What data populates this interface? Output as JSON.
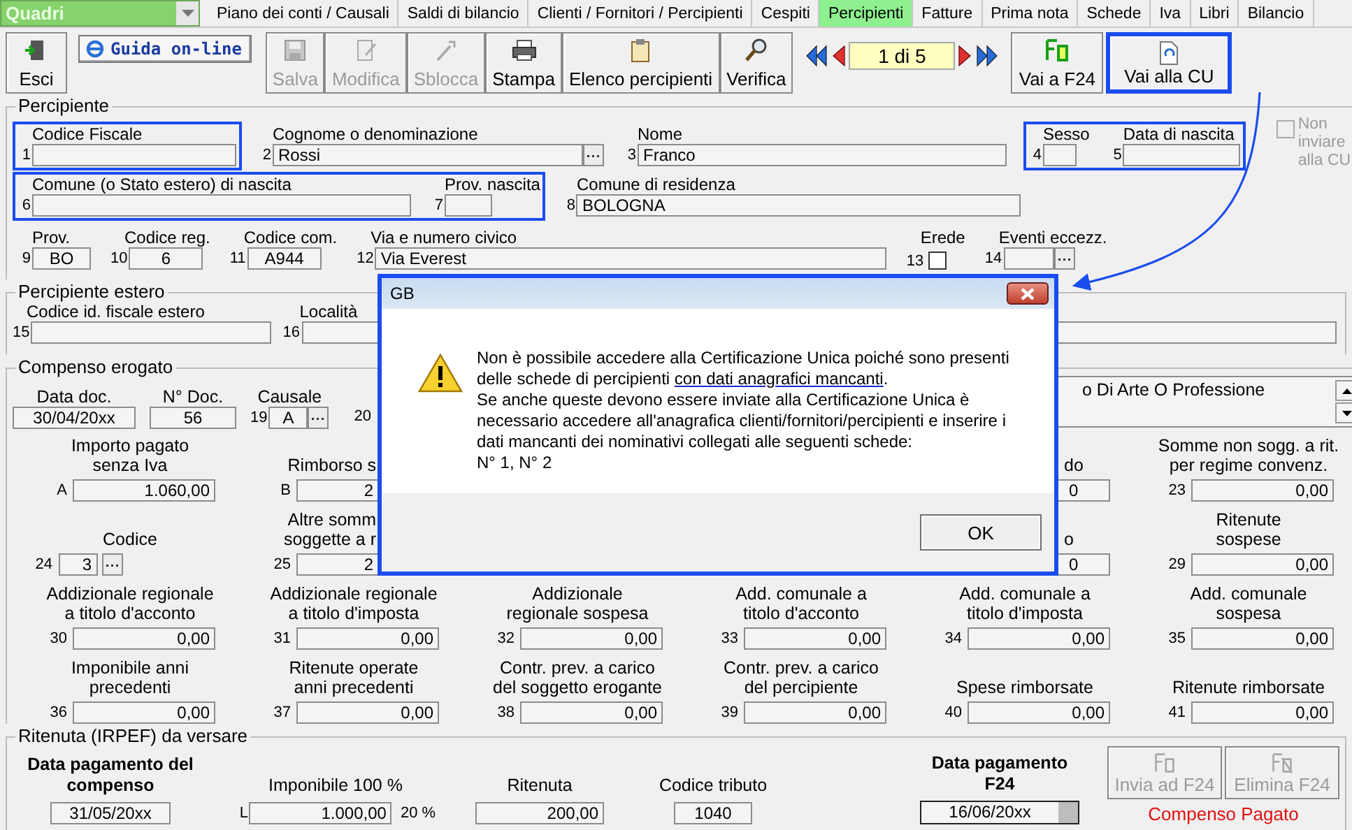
{
  "top_bar": {
    "selector": {
      "value": "Quadri"
    },
    "tabs": [
      {
        "label": "Piano dei conti / Causali",
        "selected": false
      },
      {
        "label": "Saldi di bilancio",
        "selected": false
      },
      {
        "label": "Clienti / Fornitori / Percipienti",
        "selected": false
      },
      {
        "label": "Cespiti",
        "selected": false
      },
      {
        "label": "Percipienti",
        "selected": true
      },
      {
        "label": "Fatture",
        "selected": false
      },
      {
        "label": "Prima nota",
        "selected": false
      },
      {
        "label": "Schede",
        "selected": false
      },
      {
        "label": "Iva",
        "selected": false
      },
      {
        "label": "Libri",
        "selected": false
      },
      {
        "label": "Bilancio",
        "selected": false
      }
    ]
  },
  "toolbar": {
    "exit": {
      "label": "Esci"
    },
    "help": {
      "label": "Guida on-line"
    },
    "actions": [
      {
        "kind": "save",
        "label": "Salva",
        "disabled": true
      },
      {
        "kind": "edit",
        "label": "Modifica",
        "disabled": true
      },
      {
        "kind": "unlock",
        "label": "Sblocca",
        "disabled": true
      },
      {
        "kind": "print",
        "label": "Stampa",
        "disabled": false
      },
      {
        "kind": "list",
        "label": "Elenco percipienti",
        "disabled": false
      },
      {
        "kind": "check",
        "label": "Verifica",
        "disabled": false
      }
    ],
    "record": "1 di 5",
    "goto": [
      {
        "kind": "f24",
        "label": "Vai a F24",
        "highlighted": false
      },
      {
        "kind": "cu",
        "label": "Vai alla CU",
        "highlighted": true
      }
    ]
  },
  "percipiente": {
    "title": "Percipiente",
    "rows": [
      [
        {
          "highlighted": true,
          "fields": [
            {
              "num": "1",
              "label": "Codice Fiscale",
              "kind": "text"
            }
          ]
        },
        {
          "highlighted": false,
          "fields": [
            {
              "num": "2",
              "label": "Cognome o denominazione",
              "value": "Rossi",
              "kind": "lookup"
            },
            {
              "num": "3",
              "label": "Nome",
              "value": "Franco",
              "kind": "text"
            }
          ]
        },
        {
          "highlighted": true,
          "fields": [
            {
              "num": "4",
              "label": "Sesso",
              "kind": "text"
            },
            {
              "num": "5",
              "label": "Data di nascita",
              "kind": "text"
            }
          ]
        }
      ],
      [
        {
          "highlighted": true,
          "fields": [
            {
              "num": "6",
              "label": "Comune (o Stato estero) di nascita",
              "kind": "text"
            },
            {
              "num": "7",
              "label": "Prov. nascita",
              "kind": "text"
            }
          ]
        },
        {
          "highlighted": false,
          "fields": [
            {
              "num": "8",
              "label": "Comune di residenza",
              "value": "BOLOGNA",
              "kind": "text"
            }
          ]
        }
      ],
      [
        {
          "highlighted": false,
          "fields": [
            {
              "num": "9",
              "label": "Prov.",
              "value": "BO",
              "kind": "center"
            },
            {
              "num": "10",
              "label": "Codice reg.",
              "value": "6",
              "kind": "center"
            },
            {
              "num": "11",
              "label": "Codice com.",
              "value": "A944",
              "kind": "center"
            },
            {
              "num": "12",
              "label": "Via e numero civico",
              "value": "Via Everest",
              "kind": "text"
            },
            {
              "num": "13",
              "label": "Erede",
              "checked": false,
              "kind": "check"
            },
            {
              "num": "14",
              "label": "Eventi eccezz.",
              "kind": "lookup"
            }
          ]
        }
      ]
    ],
    "exclude": {
      "label": "Non inviare alla CU",
      "checked": false,
      "disabled": true
    }
  },
  "estero": {
    "title": "Percipiente estero",
    "fields": [
      {
        "num": "15",
        "label": "Codice id. fiscale estero"
      },
      {
        "num": "16",
        "label": "Località"
      }
    ]
  },
  "compenso": {
    "title": "Compenso erogato",
    "head": {
      "date": {
        "label": "Data doc.",
        "value": "30/04/20xx"
      },
      "number": {
        "label": "N° Doc.",
        "value": "56"
      },
      "reason": {
        "num": "19",
        "label": "Causale",
        "value": "A"
      },
      "cut_num": "20",
      "description": "o Di Arte O Professione"
    },
    "rows": [
      [
        {
          "num": "A",
          "label": "Importo pagato\nsenza Iva",
          "value": "1.060,00",
          "kind": "amount"
        },
        {
          "num": "B",
          "label": "Rimborso s",
          "value": "2",
          "kind": "cut"
        },
        {
          "label": "do",
          "value": "0",
          "kind": "cut"
        },
        {
          "num": "23",
          "label": "Somme non sogg. a rit.\nper regime convenz.",
          "value": "0,00",
          "kind": "amount"
        }
      ],
      [
        {
          "num": "24",
          "label": "Codice",
          "value": "3",
          "kind": "lookup"
        },
        {
          "num": "25",
          "label": "Altre somm\nsoggette a r",
          "value": "2",
          "kind": "cut"
        },
        {
          "label": "o",
          "value": "0",
          "kind": "cut"
        },
        {
          "num": "29",
          "label": "Ritenute\nsospese",
          "value": "0,00",
          "kind": "amount"
        }
      ],
      [
        {
          "num": "30",
          "label": "Addizionale regionale\na titolo d'acconto",
          "value": "0,00",
          "kind": "amount"
        },
        {
          "num": "31",
          "label": "Addizionale regionale\na titolo d'imposta",
          "value": "0,00",
          "kind": "amount"
        },
        {
          "num": "32",
          "label": "Addizionale\nregionale sospesa",
          "value": "0,00",
          "kind": "amount"
        },
        {
          "num": "33",
          "label": "Add. comunale a\ntitolo d'acconto",
          "value": "0,00",
          "kind": "amount"
        },
        {
          "num": "34",
          "label": "Add. comunale a\ntitolo d'imposta",
          "value": "0,00",
          "kind": "amount"
        },
        {
          "num": "35",
          "label": "Add. comunale\nsospesa",
          "value": "0,00",
          "kind": "amount"
        }
      ],
      [
        {
          "num": "36",
          "label": "Imponibile anni\nprecedenti",
          "value": "0,00",
          "kind": "amount"
        },
        {
          "num": "37",
          "label": "Ritenute operate\nanni precedenti",
          "value": "0,00",
          "kind": "amount"
        },
        {
          "num": "38",
          "label": "Contr. prev. a carico\ndel soggetto erogante",
          "value": "0,00",
          "kind": "amount"
        },
        {
          "num": "39",
          "label": "Contr. prev. a carico\ndel percipiente",
          "value": "0,00",
          "kind": "amount"
        },
        {
          "num": "40",
          "label": "Spese rimborsate",
          "value": "0,00",
          "kind": "amount"
        },
        {
          "num": "41",
          "label": "Ritenute rimborsate",
          "value": "0,00",
          "kind": "amount"
        }
      ]
    ]
  },
  "ritenuta": {
    "title": "Ritenuta (IRPEF) da versare",
    "payment_date": {
      "label": "Data pagamento del\ncompenso",
      "value": "31/05/20xx"
    },
    "taxable": {
      "label": "Imponibile 100 %",
      "num": "L",
      "value": "1.000,00",
      "rate": "20 %"
    },
    "withholding": {
      "label": "Ritenuta",
      "value": "200,00"
    },
    "tax_code": {
      "label": "Codice tributo",
      "value": "1040"
    },
    "f24_date": {
      "label": "Data pagamento\nF24",
      "value": "16/06/20xx"
    },
    "buttons": [
      {
        "kind": "send",
        "label": "Invia ad F24",
        "disabled": true
      },
      {
        "kind": "delete",
        "label": "Elimina F24",
        "disabled": true
      }
    ],
    "status": "Compenso Pagato"
  },
  "dialog": {
    "title": "GB",
    "highlighted": true,
    "message": {
      "lead": "Non è possibile accedere alla Certificazione Unica poiché sono presenti delle schede di percipienti ",
      "link": "con dati anagrafici mancanti",
      "end": ".",
      "detail": "Se anche queste devono essere inviate alla Certificazione Unica è necessario accedere all'anagrafica clienti/fornitori/percipienti e inserire i dati mancanti dei nominativi collegati alle seguenti schede:",
      "records": "N° 1, N° 2"
    },
    "button": "OK"
  }
}
